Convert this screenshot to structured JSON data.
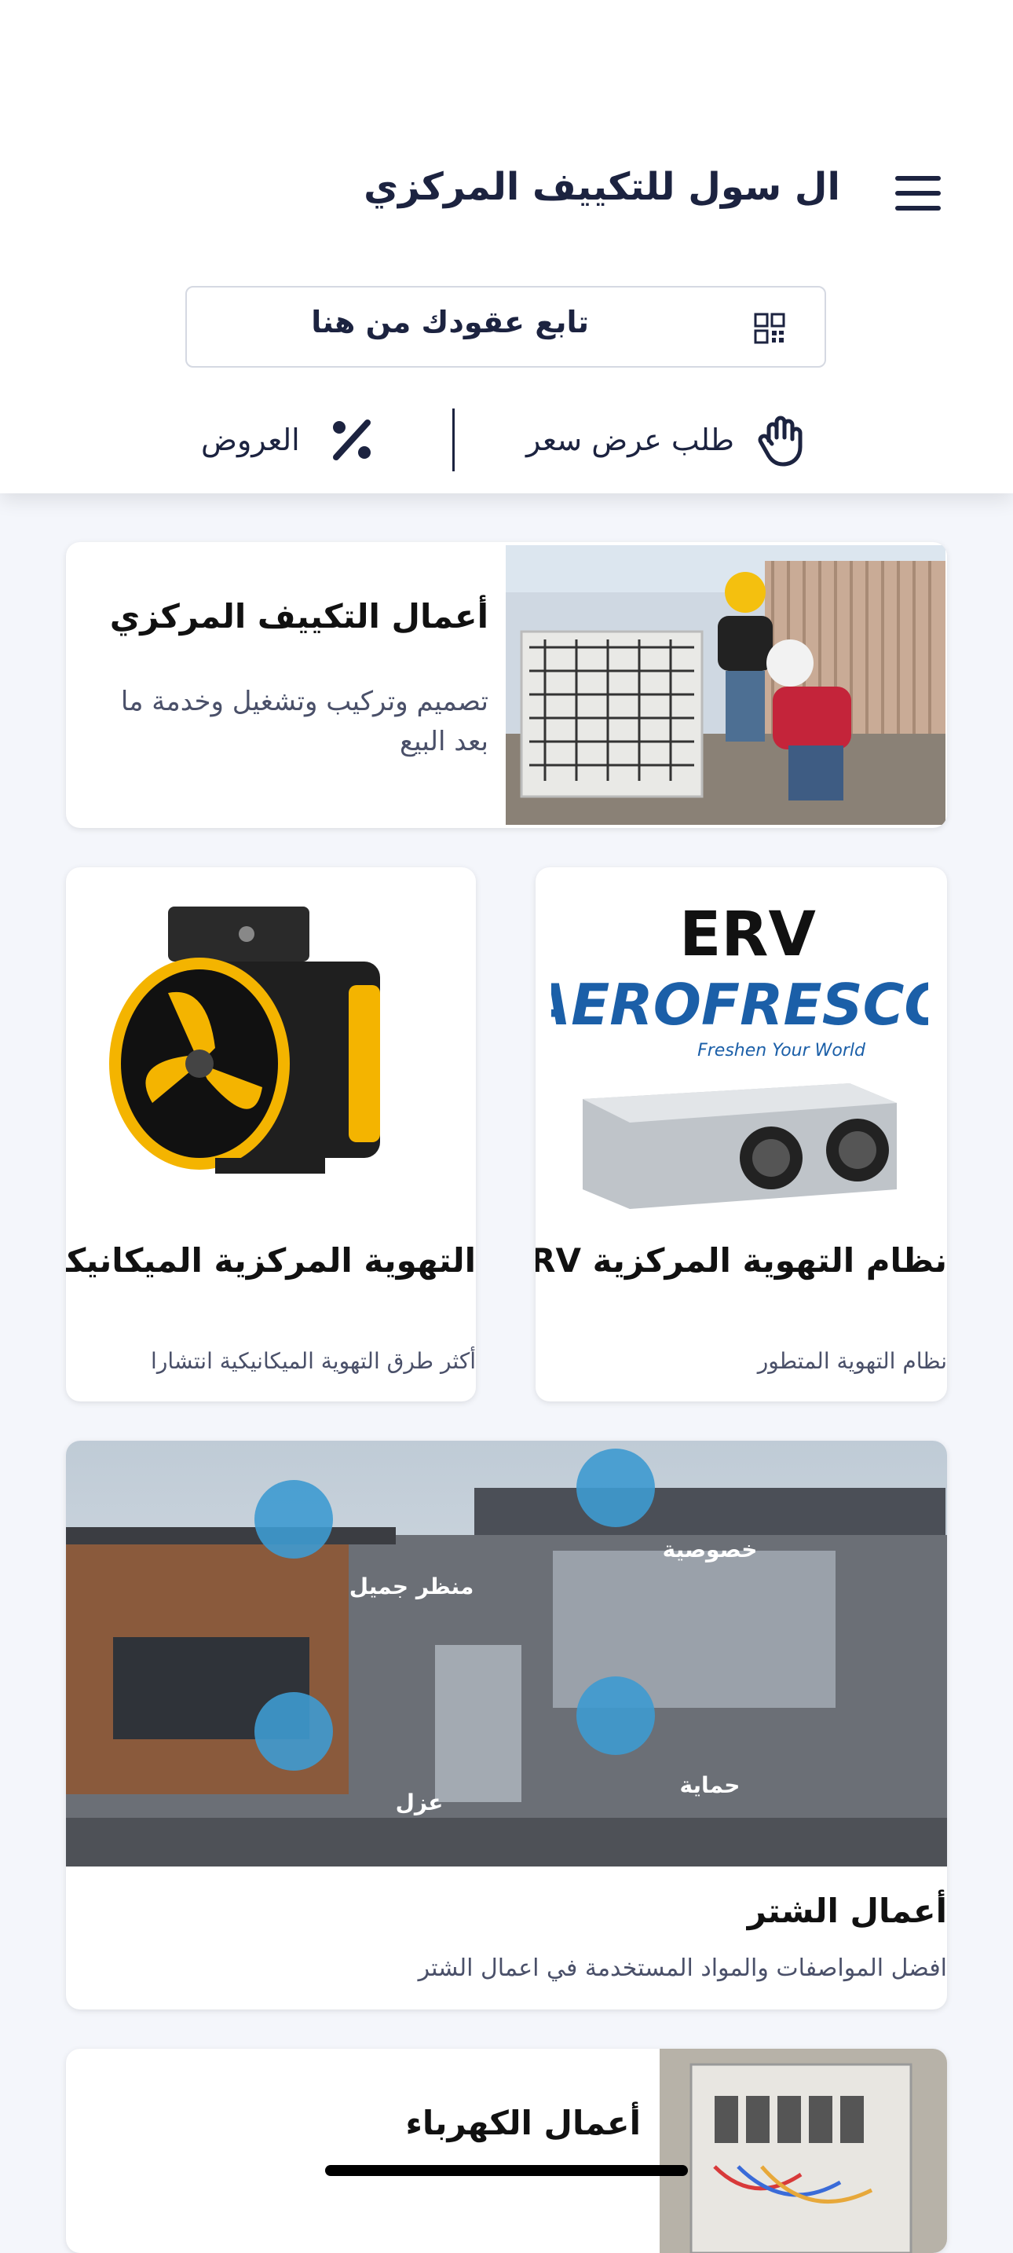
{
  "header": {
    "title": "ال سول للتكييف المركزي",
    "menu_icon": "hamburger-menu-icon",
    "track_contracts_label": "تابع عقودك من هنا",
    "qr_icon": "qr-code-icon"
  },
  "actions": {
    "quote_label": "طلب عرض سعر",
    "quote_icon": "hand-icon",
    "offers_label": "العروض",
    "offers_icon": "percent-icon"
  },
  "cards": {
    "hvac": {
      "title": "أعمال التكييف المركزي",
      "description": "تصميم وتركيب وتشغيل وخدمة ما بعد البيع"
    },
    "mechanical": {
      "title": "التهوية المركزية الميكانيكية",
      "subtitle": "أكثر طرق التهوية الميكانيكية انتشارا"
    },
    "erv": {
      "title": "نظام التهوية المركزية ERV",
      "subtitle": "نظام التهوية المتطور",
      "brand_top": "ERV",
      "brand_name": "AEROFRESCO",
      "brand_tagline": "Freshen Your World"
    },
    "shutter": {
      "title": "أعمال الشتر",
      "subtitle": "افضل المواصفات والمواد المستخدمة في اعمال الشتر",
      "labels": {
        "privacy": "خصوصية",
        "view": "منظر جميل",
        "protection": "حماية",
        "insulation": "عزل"
      }
    },
    "electrical": {
      "title": "أعمال الكهرباء"
    }
  },
  "colors": {
    "primary": "#1c2340",
    "background": "#f4f6fb",
    "accent_blue": "#1b5fa8"
  }
}
